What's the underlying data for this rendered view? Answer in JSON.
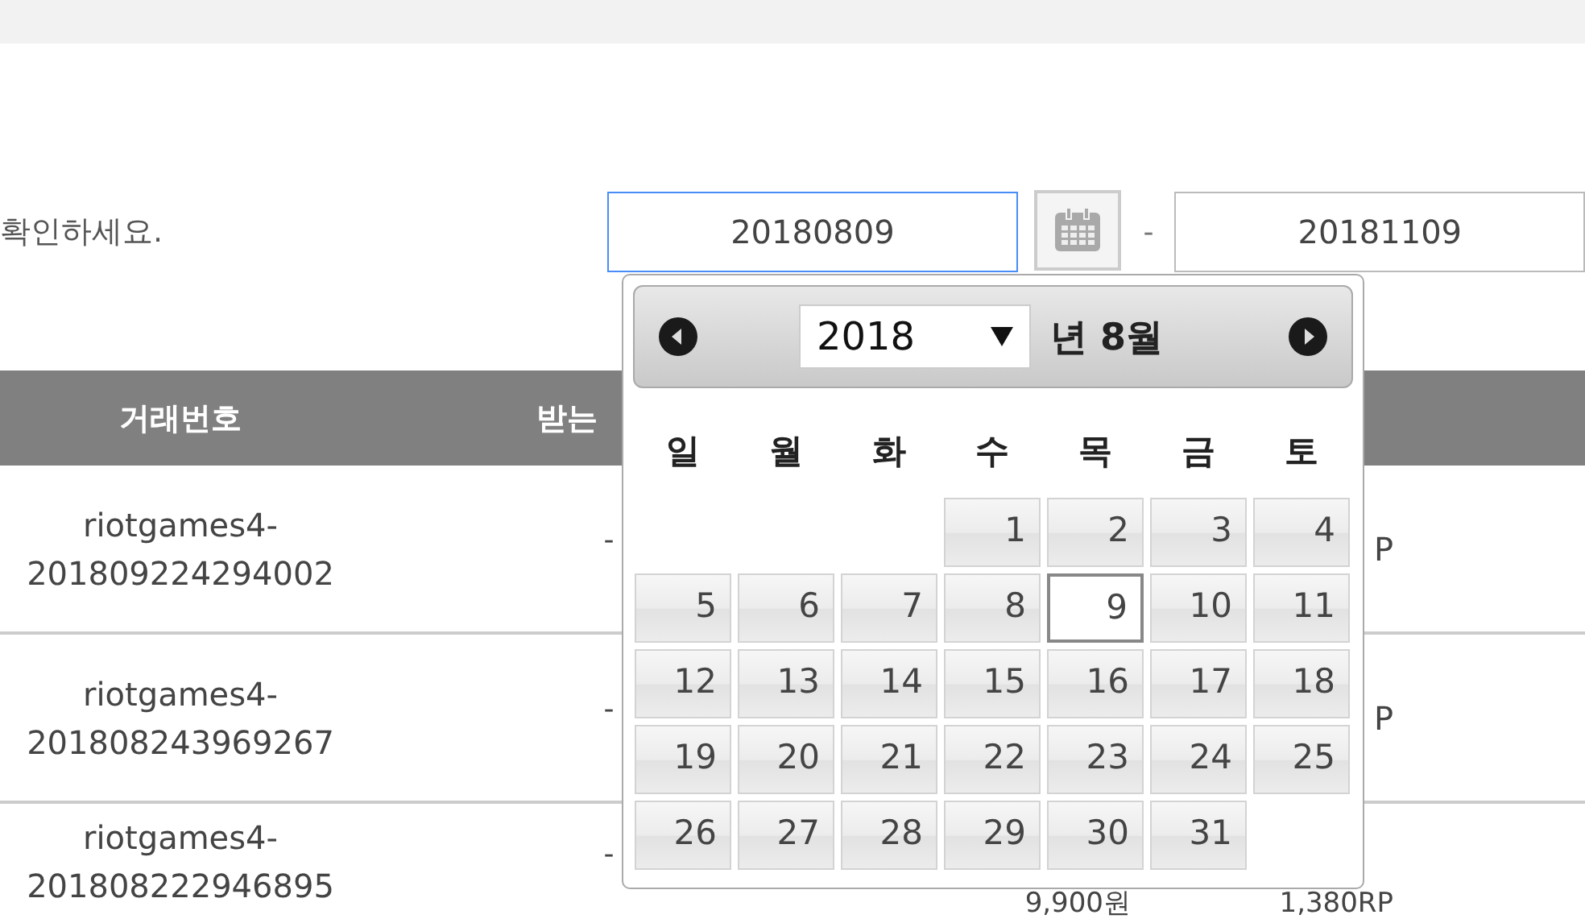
{
  "notice": {
    "text": "확인하세요."
  },
  "date_range": {
    "start": {
      "value": "20180809",
      "focused": true
    },
    "separator": "-",
    "end": {
      "value": "20181109"
    }
  },
  "table": {
    "columns": [
      "거래번호",
      "받는"
    ],
    "rows": [
      {
        "id_line1": "riotgames4-",
        "id_line2": "201809224294002",
        "column_2": "-",
        "column_4": "P"
      },
      {
        "id_line1": "riotgames4-",
        "id_line2": "201808243969267",
        "column_2": "-",
        "column_4": "P"
      },
      {
        "id_line1": "riotgames4-",
        "id_line2": "201808222946895",
        "column_2": "-",
        "column_3": "9,900원",
        "column_4": "1,380RP"
      }
    ]
  },
  "datepicker": {
    "year": "2018",
    "month_label": "년 8월",
    "weekdays": [
      "일",
      "월",
      "화",
      "수",
      "목",
      "금",
      "토"
    ],
    "days": [
      {
        "label": "1",
        "selected": false
      },
      {
        "label": "2",
        "selected": false
      },
      {
        "label": "3",
        "selected": false
      },
      {
        "label": "4",
        "selected": false
      },
      {
        "label": "5",
        "selected": false
      },
      {
        "label": "6",
        "selected": false
      },
      {
        "label": "7",
        "selected": false
      },
      {
        "label": "8",
        "selected": false
      },
      {
        "label": "9",
        "selected": true
      },
      {
        "label": "10",
        "selected": false
      },
      {
        "label": "11",
        "selected": false
      },
      {
        "label": "12",
        "selected": false
      },
      {
        "label": "13",
        "selected": false
      },
      {
        "label": "14",
        "selected": false
      },
      {
        "label": "15",
        "selected": false
      },
      {
        "label": "16",
        "selected": false
      },
      {
        "label": "17",
        "selected": false
      },
      {
        "label": "18",
        "selected": false
      },
      {
        "label": "19",
        "selected": false
      },
      {
        "label": "20",
        "selected": false
      },
      {
        "label": "21",
        "selected": false
      },
      {
        "label": "22",
        "selected": false
      },
      {
        "label": "23",
        "selected": false
      },
      {
        "label": "24",
        "selected": false
      },
      {
        "label": "25",
        "selected": false
      },
      {
        "label": "26",
        "selected": false
      },
      {
        "label": "27",
        "selected": false
      },
      {
        "label": "28",
        "selected": false
      },
      {
        "label": "29",
        "selected": false
      },
      {
        "label": "30",
        "selected": false
      },
      {
        "label": "31",
        "selected": false
      }
    ]
  }
}
